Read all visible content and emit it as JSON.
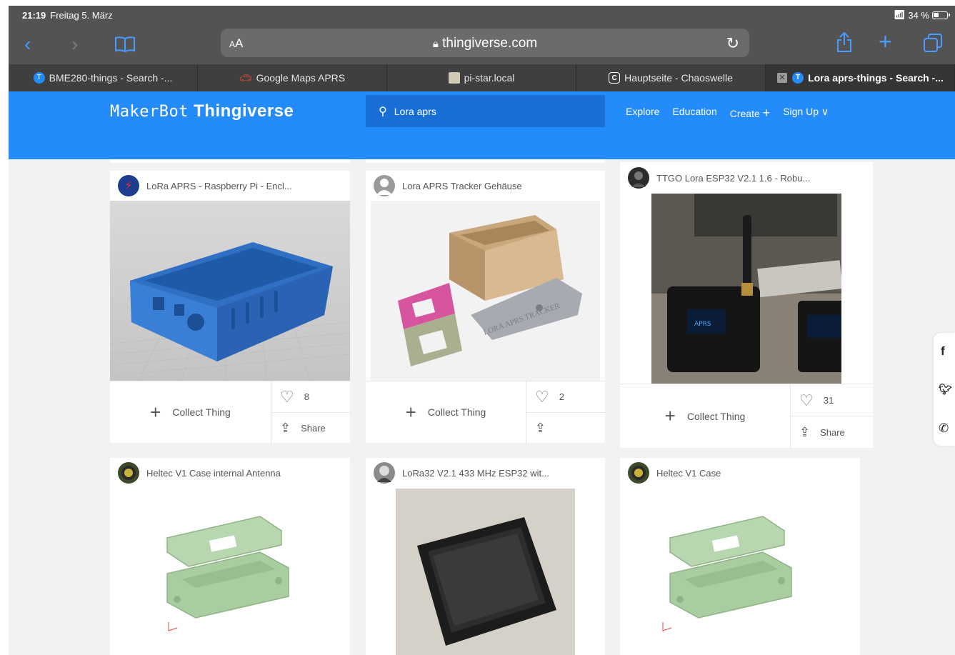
{
  "status": {
    "time": "21:19",
    "date": "Freitag 5. März",
    "battery": "34 %"
  },
  "safari": {
    "text_size_label": "AA",
    "host": "thingiverse.com",
    "tabs": [
      {
        "label": "BME280-things - Search -...",
        "favicon": "thingiverse-icon"
      },
      {
        "label": "Google Maps APRS",
        "favicon": "car-icon"
      },
      {
        "label": "pi-star.local",
        "favicon": "pistar-icon"
      },
      {
        "label": "Hauptseite - Chaoswelle",
        "favicon": "c-icon"
      },
      {
        "label": "Lora aprs-things - Search -...",
        "favicon": "thingiverse-icon"
      }
    ]
  },
  "header": {
    "logo_makerbot": "MakerBot",
    "logo_thingiverse": "Thingiverse",
    "search_value": "Lora aprs",
    "nav": [
      "Explore",
      "Education",
      "Create",
      "Sign Up"
    ]
  },
  "cards": [
    {
      "title": "LoRa APRS - Raspberry Pi - Encl...",
      "collect": "Collect Thing",
      "likes": "8",
      "share": "Share"
    },
    {
      "title": "Lora APRS Tracker Gehäuse",
      "collect": "Collect Thing",
      "likes": "2",
      "share": ""
    },
    {
      "title": "TTGO Lora ESP32 V2.1 1.6 - Robu...",
      "collect": "Collect Thing",
      "likes": "31",
      "share": "Share"
    },
    {
      "title": "Heltec V1 Case internal Antenna"
    },
    {
      "title": "LoRa32 V2.1 433 MHz ESP32 wit..."
    },
    {
      "title": "Heltec V1 Case"
    }
  ],
  "colors": {
    "brand_blue": "#248bfb",
    "safari_chrome": "#535353",
    "tab_bar": "#3f3f3f"
  }
}
